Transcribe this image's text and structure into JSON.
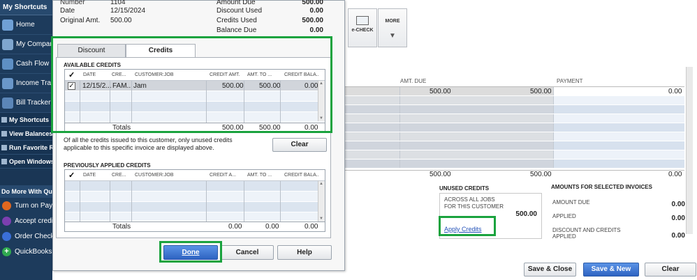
{
  "sidebar": {
    "header": "My Shortcuts",
    "items": [
      {
        "label": "Home",
        "icon": "home-icon"
      },
      {
        "label": "My Company",
        "icon": "company-icon"
      },
      {
        "label": "Cash Flow H",
        "icon": "cashflow-icon"
      },
      {
        "label": "Income Trac",
        "icon": "income-tracker-icon"
      },
      {
        "label": "Bill Tracker",
        "icon": "bill-tracker-icon"
      }
    ],
    "sections": [
      "My Shortcuts",
      "View Balances",
      "Run Favorite Re",
      "Open Windows"
    ],
    "do_more_header": "Do More With Quic",
    "do_more": [
      {
        "label": "Turn on Payr",
        "color": "#e0671f"
      },
      {
        "label": "Accept credit",
        "color": "#7b3fb0"
      },
      {
        "label": "Order Checks",
        "color": "#3a6fd8"
      },
      {
        "label": "QuickBooks E",
        "color": "#2fa84f"
      }
    ]
  },
  "invoice_header": {
    "number_label": "Number",
    "number_value": "1104",
    "date_label": "Date",
    "date_value": "12/15/2024",
    "orig_label": "Original Amt.",
    "orig_value": "500.00",
    "amount_due_label": "Amount Due",
    "amount_due_value": "500.00",
    "discount_used_label": "Discount Used",
    "discount_used_value": "0.00",
    "credits_used_label": "Credits Used",
    "credits_used_value": "500.00",
    "balance_due_label": "Balance Due",
    "balance_due_value": "0.00"
  },
  "tabs": {
    "discount": "Discount",
    "credits": "Credits"
  },
  "available_credits": {
    "title": "AVAILABLE CREDITS",
    "columns": [
      "✓",
      "DATE",
      "CRE...",
      "CUSTOMER:JOB",
      "CREDIT AMT.",
      "AMT. TO ...",
      "CREDIT BALA..."
    ],
    "row": {
      "check": "✓",
      "date": "12/15/2...",
      "credit_no": "FAM...",
      "customer": "Jam",
      "credit_amt": "500.00",
      "amt_to_use": "500.00",
      "credit_balance": "0.00"
    },
    "totals_label": "Totals",
    "totals": {
      "credit_amt": "500.00",
      "amt_to_use": "500.00",
      "credit_balance": "0.00"
    }
  },
  "note": "Of all the credits issued to this customer, only unused credits applicable to this specific invoice are displayed above.",
  "clear_button": "Clear",
  "previously_applied": {
    "title": "PREVIOUSLY APPLIED CREDITS",
    "columns": [
      "✓",
      "DATE",
      "CRE...",
      "CUSTOMER:JOB",
      "CREDIT A...",
      "AMT. TO ...",
      "CREDIT BALA..."
    ],
    "totals_label": "Totals",
    "totals": {
      "credit_amt": "0.00",
      "amt_to_use": "0.00",
      "credit_balance": "0.00"
    }
  },
  "dialog_buttons": {
    "done": "Done",
    "cancel": "Cancel",
    "help": "Help"
  },
  "toolbar": {
    "echeck": "e-CHECK",
    "more": "MORE"
  },
  "invoice_grid": {
    "headers": {
      "amt_due": "AMT. DUE",
      "payment": "PAYMENT"
    },
    "first_row": {
      "col_a": "500.00",
      "amt_due": "500.00",
      "payment": "0.00"
    },
    "totals": {
      "col_a": "500.00",
      "amt_due": "500.00",
      "payment": "0.00"
    }
  },
  "unused_credits": {
    "title": "UNUSED CREDITS",
    "line1": "ACROSS ALL JOBS",
    "line2": "FOR THIS CUSTOMER",
    "value": "500.00",
    "apply_link": "Apply Credits"
  },
  "amounts_selected": {
    "title": "AMOUNTS FOR SELECTED INVOICES",
    "amount_due_label": "AMOUNT DUE",
    "amount_due_value": "0.00",
    "applied_label": "APPLIED",
    "applied_value": "0.00",
    "discount_label": "DISCOUNT AND CREDITS",
    "discount_label2": "APPLIED",
    "discount_value": "0.00"
  },
  "bottom_buttons": {
    "save_close": "Save & Close",
    "save_new": "Save & New",
    "clear": "Clear"
  }
}
